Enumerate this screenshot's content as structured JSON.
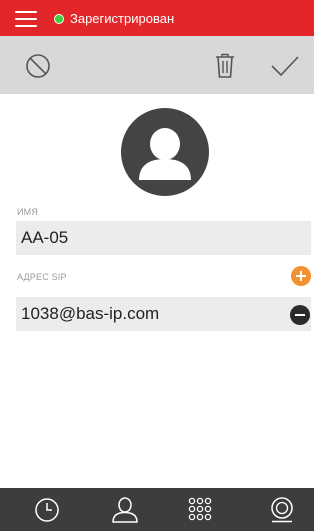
{
  "statusbar": {
    "status_text": "Зарегистрирован",
    "status_color": "#3fcf3f",
    "bar_color": "#e3262a"
  },
  "toolbar": {
    "cancel_icon": "cancel-icon",
    "delete_icon": "trash-icon",
    "save_icon": "checkmark-icon"
  },
  "contact": {
    "avatar_icon": "person-icon",
    "name_label": "ИМЯ",
    "name_value": "AA-05",
    "sip_label": "АДРЕС SIP",
    "sip_value": "1038@bas-ip.com",
    "add_sip_icon": "plus-icon",
    "remove_sip_icon": "minus-icon"
  },
  "bottom_nav": {
    "items": [
      {
        "icon": "clock-icon"
      },
      {
        "icon": "person-outline-icon"
      },
      {
        "icon": "dialpad-icon"
      },
      {
        "icon": "camera-icon"
      }
    ]
  },
  "colors": {
    "accent_red": "#e3262a",
    "add_orange": "#f39131",
    "nav_bg": "#3d3d3d"
  }
}
